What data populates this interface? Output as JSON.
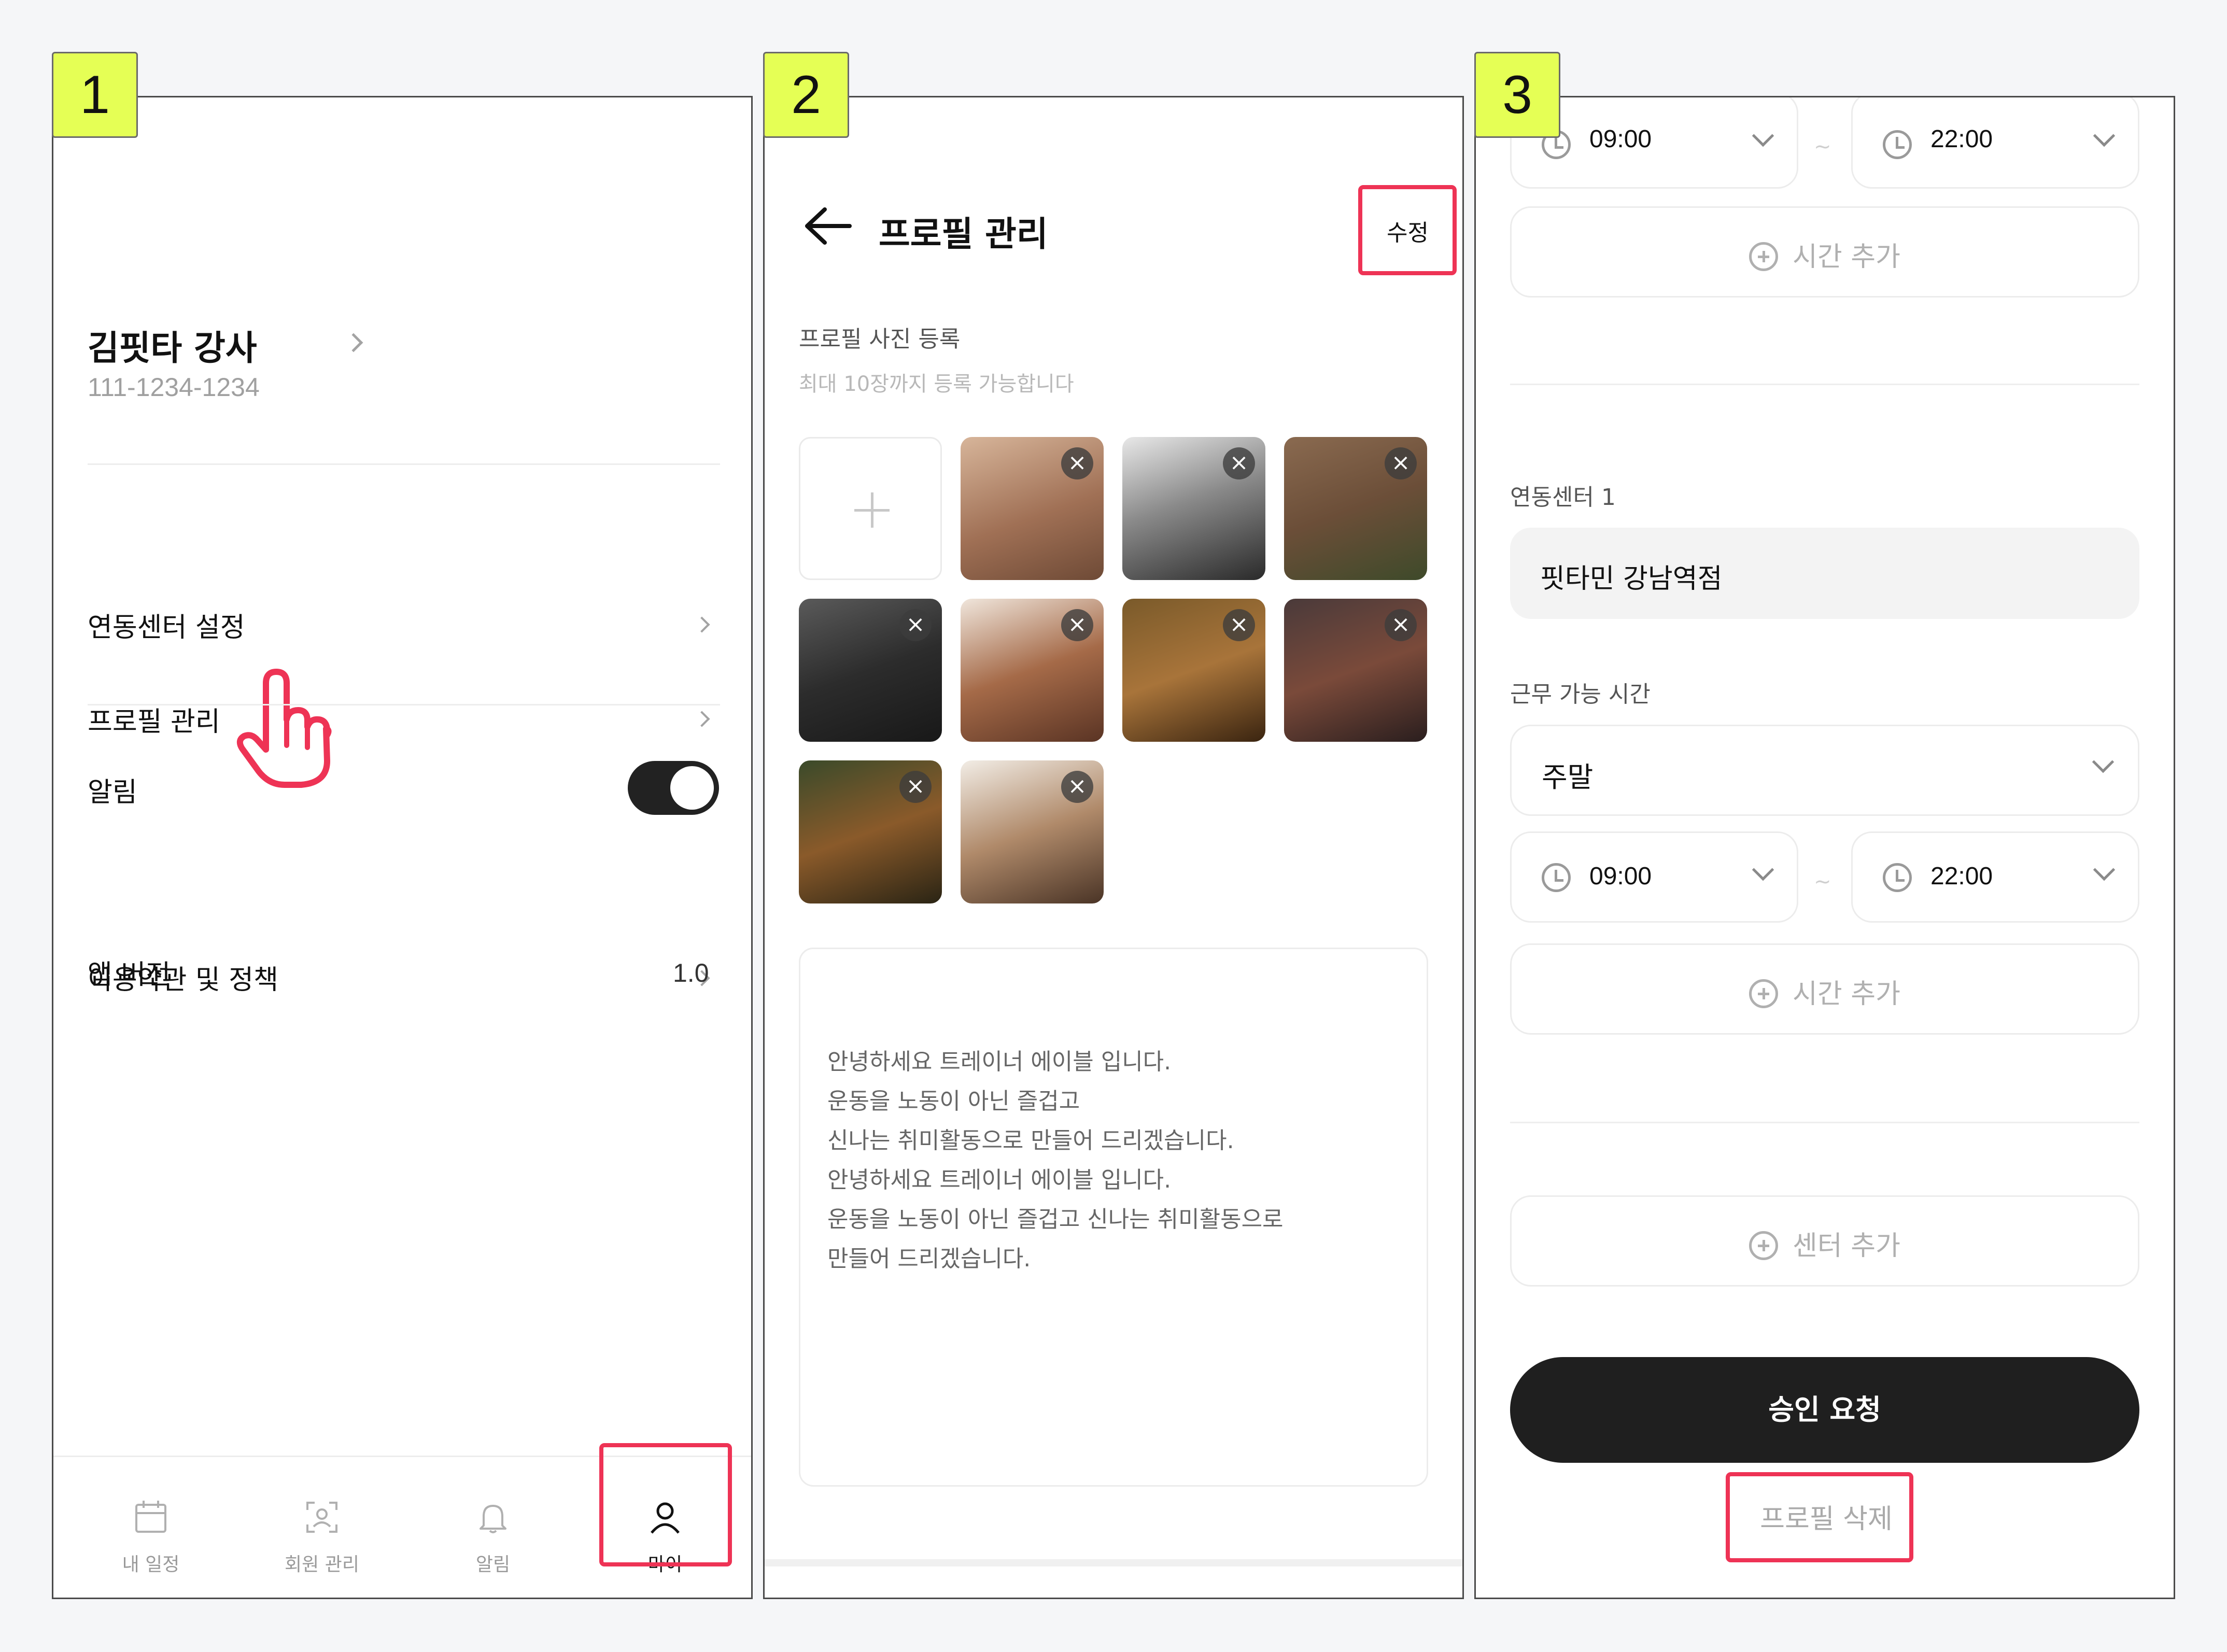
{
  "steps": {
    "one": "1",
    "two": "2",
    "three": "3"
  },
  "my_page": {
    "user_name": "김핏타 강사",
    "phone": "111-1234-1234",
    "menu": {
      "center_settings": "연동센터 설정",
      "profile_manage": "프로필 관리",
      "notifications": "알림",
      "terms": "이용약관 및 정책",
      "app_version_label": "앱 버전",
      "app_version_value": "1.0"
    },
    "notifications_on": true,
    "nav": {
      "schedule": "내 일정",
      "members": "회원 관리",
      "alerts": "알림",
      "my": "마이"
    }
  },
  "profile": {
    "title": "프로필 관리",
    "edit": "수정",
    "photo_section": "프로필 사진 등록",
    "photo_hint": "최대 10장까지 등록 가능합니다",
    "photo_count": 10,
    "intro_lines": [
      "안녕하세요 트레이너 에이블 입니다.",
      "운동을 노동이 아닌 즐겁고",
      "신나는 취미활동으로 만들어 드리겠습니다.",
      "안녕하세요 트레이너 에이블 입니다.",
      "운동을 노동이 아닌 즐겁고 신나는 취미활동으로",
      "만들어 드리겠습니다."
    ]
  },
  "centers": {
    "top_start": "09:00",
    "top_end": "22:00",
    "add_time": "시간 추가",
    "center_label": "연동센터 1",
    "center_name": "핏타민 강남역점",
    "hours_label": "근무 가능 시간",
    "day_option": "주말",
    "start": "09:00",
    "end": "22:00",
    "add_center": "센터 추가",
    "approve": "승인 요청",
    "delete": "프로필 삭제"
  },
  "colors": {
    "highlight": "#ee3355",
    "step_badge": "#e5ff55",
    "primary_button": "#1f1f1f"
  }
}
